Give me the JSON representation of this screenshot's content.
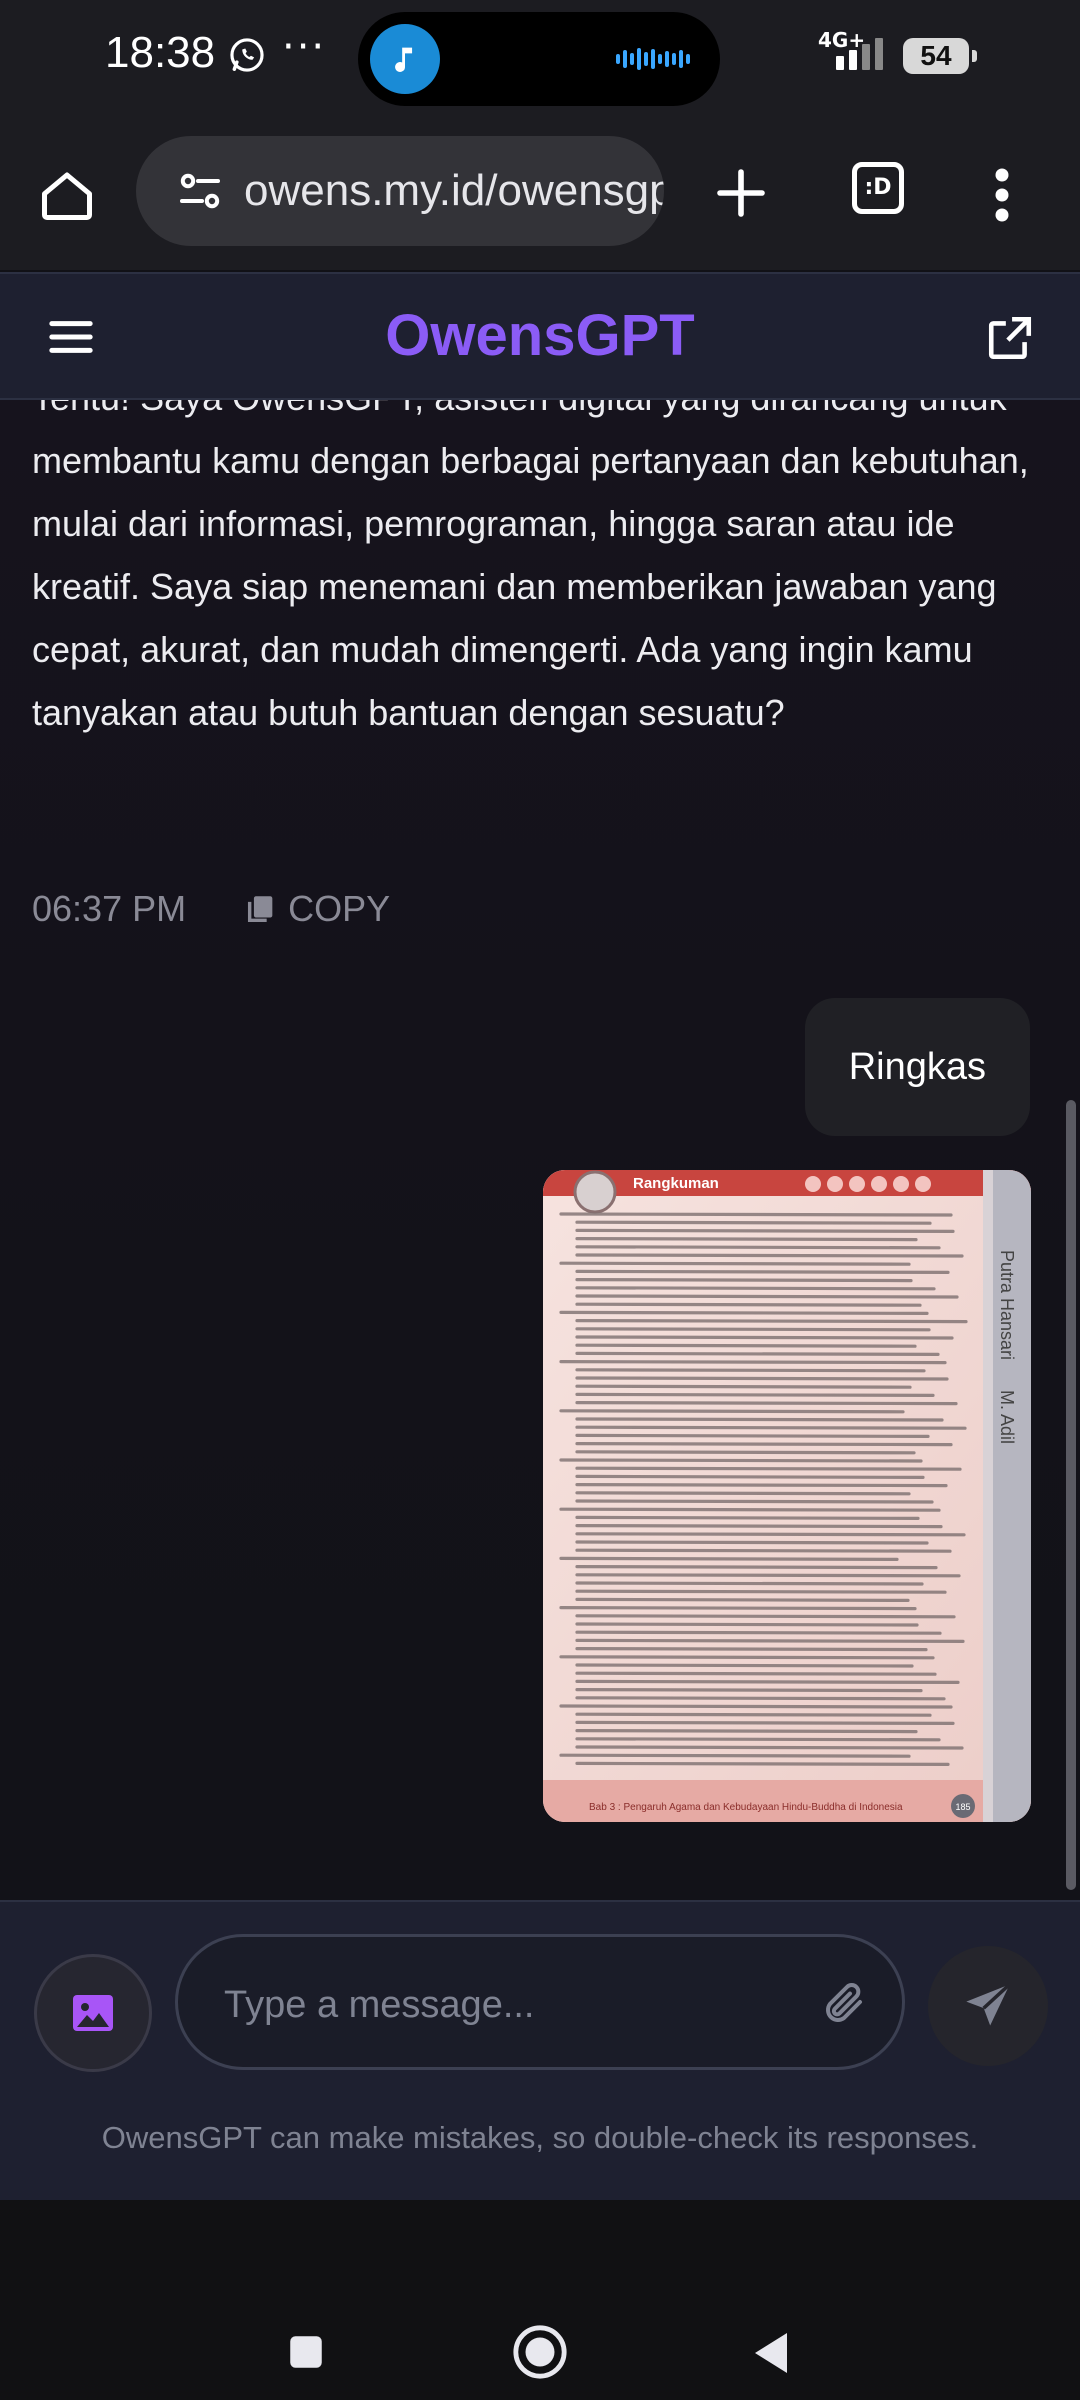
{
  "status_bar": {
    "time": "18:38",
    "more": "···",
    "network": "4G+",
    "battery": "54"
  },
  "browser": {
    "url": "owens.my.id/owensgpt",
    "tab_switcher_label": ":D"
  },
  "app": {
    "title": "OwensGPT",
    "accent_color": "#8b5cf6"
  },
  "chat": {
    "assistant_message": "Tentu! Saya OwensGPT, asisten digital yang dirancang untuk membantu kamu dengan berbagai pertanyaan dan kebutuhan, mulai dari informasi, pemrograman, hingga saran atau ide kreatif. Saya siap menemani dan memberikan jawaban yang cepat, akurat, dan mudah dimengerti. Ada yang ingin kamu tanyakan atau butuh bantuan dengan sesuatu?",
    "timestamp": "06:37 PM",
    "copy_label": "COPY",
    "user_message": "Ringkas",
    "attachment": {
      "heading": "Rangkuman",
      "side_text_1": "Putra Hansari",
      "side_text_2": "M. Adil",
      "footer_text": "Bab 3 : Pengaruh Agama dan Kebudayaan Hindu-Buddha di Indonesia",
      "page_number": "185"
    }
  },
  "composer": {
    "placeholder": "Type a message...",
    "disclaimer": "OwensGPT can make mistakes, so double-check its responses."
  }
}
